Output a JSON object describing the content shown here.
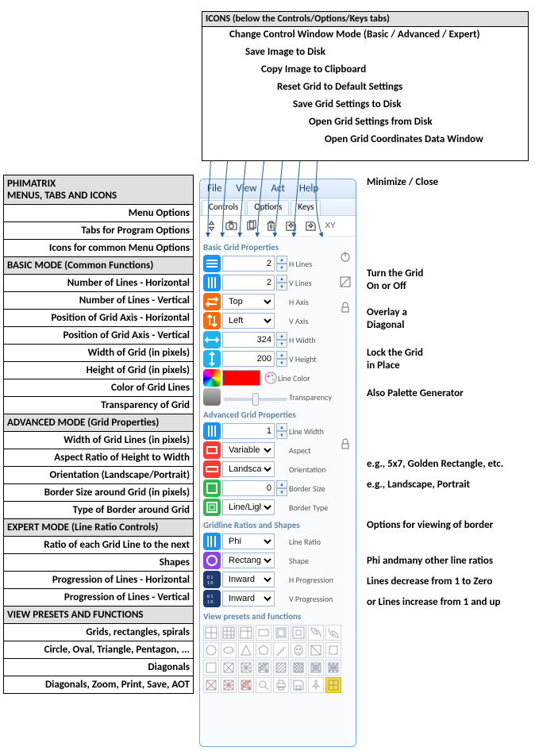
{
  "icons_box": {
    "header": "ICONS (below the Controls/Options/Keys tabs)",
    "lines": [
      "Change Control Window Mode (Basic / Advanced / Expert)",
      "Save Image to Disk",
      "Copy Image to Clipboard",
      "Reset Grid to Default Settings",
      "Save Grid Settings to Disk",
      "Open Grid Settings from Disk",
      "Open Grid Coordinates Data Window"
    ]
  },
  "left": {
    "title1": "PHIMATRIX",
    "title2": "MENUS, TABS AND ICONS",
    "rows_top": [
      "Menu Options",
      "Tabs for Program Options",
      "Icons for common Menu Options"
    ],
    "head_basic": "BASIC MODE (Common Functions)",
    "rows_basic": [
      "Number of Lines - Horizontal",
      "Number of Lines - Vertical",
      "Position of Grid Axis - Horizontal",
      "Position of Grid Axis - Vertical",
      "Width of Grid (in pixels)",
      "Height of Grid (in pixels)",
      "Color of Grid Lines",
      "Transparency of Grid"
    ],
    "head_adv": "ADVANCED MODE (Grid Properties)",
    "rows_adv": [
      "Width of Grid Lines (in pixels)",
      "Aspect Ratio of Height to Width",
      "Orientation (Landscape/Portrait)",
      "Border Size around Grid (in pixels)",
      "Type of Border around Grid"
    ],
    "head_exp": "EXPERT MODE (Line Ratio Controls)",
    "rows_exp": [
      "Ratio of each Grid Line to the next",
      "Shapes",
      "Progression of Lines - Horizontal",
      "Progression of Lines - Vertical"
    ],
    "head_view": "VIEW PRESETS AND FUNCTIONS",
    "rows_view": [
      "Grids, rectangles, spirals",
      "Circle, Oval, Triangle, Pentagon, ...",
      "Diagonals",
      "Diagonals, Zoom, Print, Save, AOT"
    ]
  },
  "app": {
    "menubar": [
      "File",
      "View",
      "Act",
      "Help"
    ],
    "tabs": [
      "Controls",
      "Options",
      "Keys"
    ],
    "toolbar_xy": "XY",
    "sec_basic": "Basic Grid Properties",
    "sec_adv": "Advanced Grid Properties",
    "sec_exp": "Gridline Ratios and Shapes",
    "sec_view": "View presets and functions",
    "basic": {
      "hlines_val": "2",
      "hlines_lbl": "H Lines",
      "vlines_val": "2",
      "vlines_lbl": "V Lines",
      "haxis_val": "Top",
      "haxis_lbl": "H Axis",
      "vaxis_val": "Left",
      "vaxis_lbl": "V Axis",
      "hwidth_val": "324",
      "hwidth_lbl": "H Width",
      "vheight_val": "200",
      "vheight_lbl": "V Height",
      "linecolor_lbl": "Line Color",
      "transparency_lbl": "Transparency"
    },
    "adv": {
      "linewidth_val": "1",
      "linewidth_lbl": "Line Width",
      "aspect_val": "Variable",
      "aspect_lbl": "Aspect",
      "orient_val": "Landscape",
      "orient_lbl": "Orientation",
      "border_val": "0",
      "border_lbl": "Border Size",
      "btype_val": "Line/Light",
      "btype_lbl": "Border Type"
    },
    "exp": {
      "ratio_val": "Phi",
      "ratio_lbl": "Line Ratio",
      "shape_val": "Rectangle",
      "shape_lbl": "Shape",
      "hprog_val": "Inward",
      "hprog_lbl": "H Progression",
      "vprog_val": "Inward",
      "vprog_lbl": "V Progression"
    }
  },
  "right": {
    "minimize": "Minimize / Close",
    "n1a": "Turn the Grid",
    "n1b": "On or Off",
    "n2a": "Overlay a",
    "n2b": "Diagonal",
    "n3a": "Lock the Grid",
    "n3b": "in Place",
    "n4": "Also Palette Generator",
    "n5": "e.g., 5x7, Golden Rectangle, etc.",
    "n6": "e.g., Landscape, Portrait",
    "n7": "Options for viewing of border",
    "n8": "Phi andmany other line ratios",
    "n9": "Lines decrease from 1 to Zero",
    "n10": "or Lines increase from 1 and up"
  }
}
